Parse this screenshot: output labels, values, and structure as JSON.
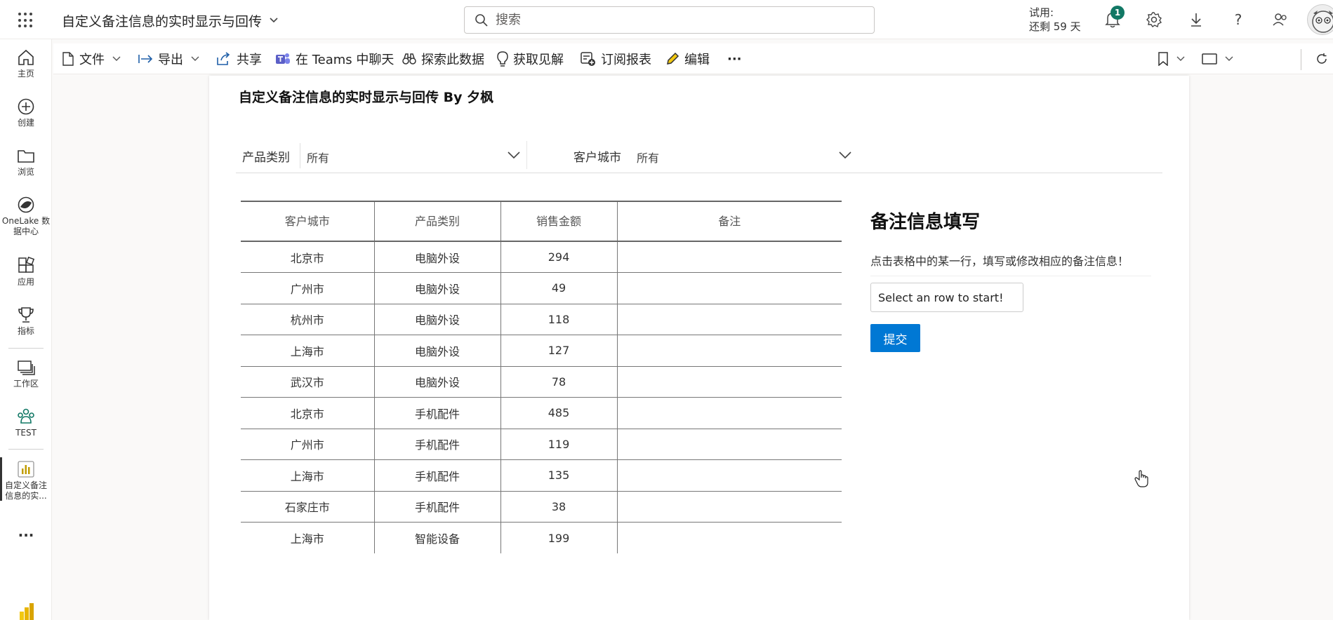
{
  "header": {
    "report_title": "自定义备注信息的实时显示与回传",
    "search_placeholder": "搜索",
    "trial_line1": "试用:",
    "trial_line2": "还剩 59 天",
    "notification_count": "1"
  },
  "sidebar": {
    "items": [
      {
        "label": "主页",
        "icon": "home-icon"
      },
      {
        "label": "创建",
        "icon": "plus-circle-icon"
      },
      {
        "label": "浏览",
        "icon": "folder-icon"
      },
      {
        "label": "OneLake 数据中心",
        "label_line1": "OneLake 数",
        "label_line2": "据中心",
        "icon": "onelake-icon"
      },
      {
        "label": "应用",
        "icon": "apps-icon"
      },
      {
        "label": "指标",
        "icon": "trophy-icon"
      },
      {
        "label": "工作区",
        "icon": "workspaces-icon"
      },
      {
        "label": "TEST",
        "icon": "team-icon"
      },
      {
        "label": "自定义备注信息的实...",
        "label_line1": "自定义备注",
        "label_line2": "信息的实...",
        "icon": "report-icon"
      }
    ],
    "more": "..."
  },
  "toolbar": {
    "file": "文件",
    "export": "导出",
    "share": "共享",
    "teams_chat": "在 Teams 中聊天",
    "explore": "探索此数据",
    "insights": "获取见解",
    "subscribe": "订阅报表",
    "edit": "编辑",
    "more": "···"
  },
  "report": {
    "title": "自定义备注信息的实时显示与回传 By 夕枫",
    "slicers": [
      {
        "label": "产品类别",
        "value": "所有"
      },
      {
        "label": "客户城市",
        "value": "所有"
      }
    ],
    "table": {
      "columns": [
        "客户城市",
        "产品类别",
        "销售金额",
        "备注"
      ],
      "rows": [
        [
          "北京市",
          "电脑外设",
          "294",
          ""
        ],
        [
          "广州市",
          "电脑外设",
          "49",
          ""
        ],
        [
          "杭州市",
          "电脑外设",
          "118",
          ""
        ],
        [
          "上海市",
          "电脑外设",
          "127",
          ""
        ],
        [
          "武汉市",
          "电脑外设",
          "78",
          ""
        ],
        [
          "北京市",
          "手机配件",
          "485",
          ""
        ],
        [
          "广州市",
          "手机配件",
          "119",
          ""
        ],
        [
          "上海市",
          "手机配件",
          "135",
          ""
        ],
        [
          "石家庄市",
          "手机配件",
          "38",
          ""
        ],
        [
          "上海市",
          "智能设备",
          "199",
          ""
        ]
      ]
    },
    "note_form": {
      "title": "备注信息填写",
      "hint": "点击表格中的某一行，填写或修改相应的备注信息！",
      "input_value": "Select an row to start!",
      "submit_label": "提交"
    }
  },
  "colors": {
    "accent": "#0078d4",
    "badge": "#117865",
    "teams": "#5b5fc7",
    "fabric_green": "#117865",
    "powerbi_yellow": "#f2c811"
  }
}
